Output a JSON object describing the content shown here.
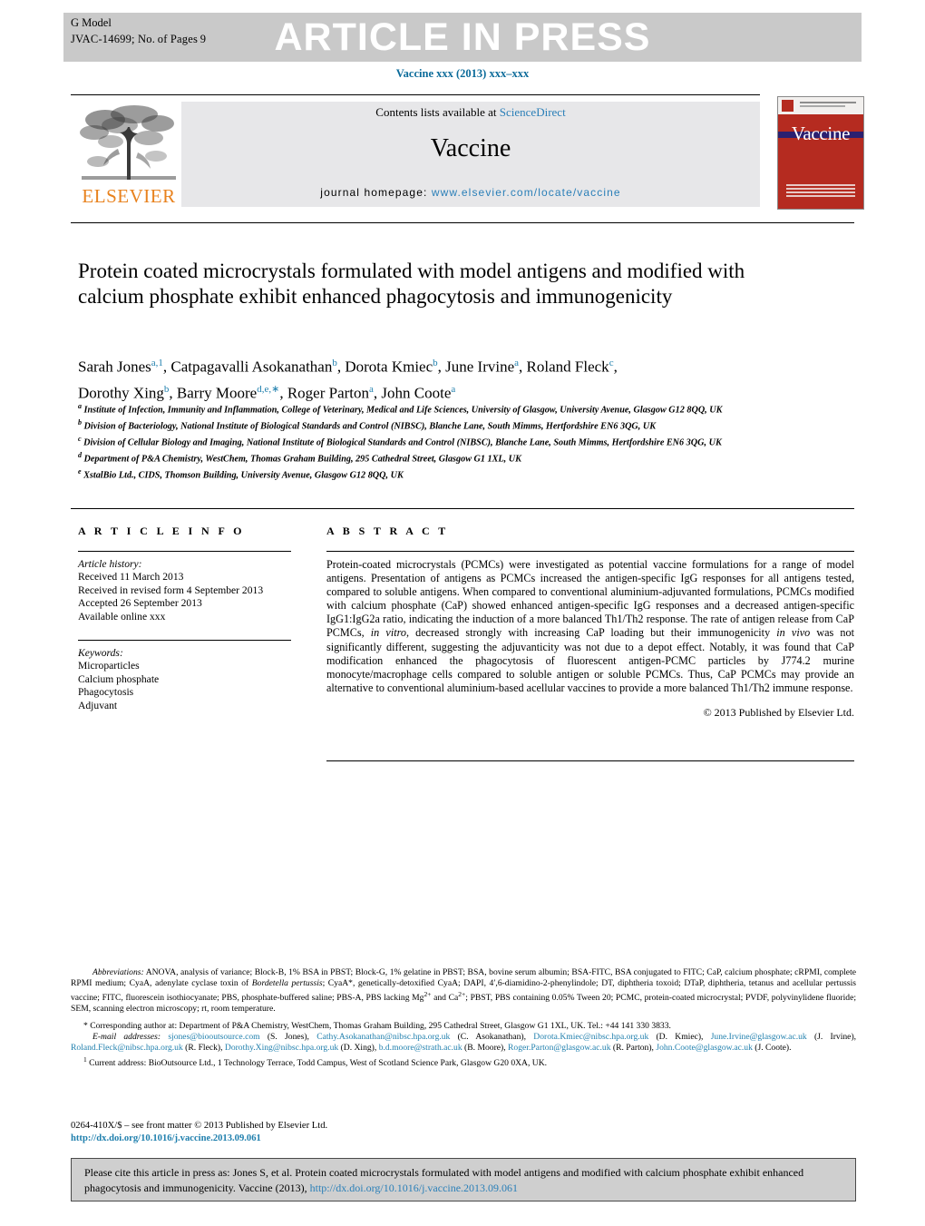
{
  "header": {
    "g_model": "G Model",
    "article_id": "JVAC-14699;   No. of Pages 9",
    "banner": "ARTICLE IN PRESS",
    "journal_ref": "Vaccine xxx (2013) xxx–xxx"
  },
  "masthead": {
    "contents_prefix": "Contents lists available at ",
    "sciencedirect": "ScienceDirect",
    "journal_title": "Vaccine",
    "homepage_label": "journal homepage: ",
    "homepage_url": "www.elsevier.com/locate/vaccine",
    "publisher": "ELSEVIER",
    "cover_title": "Vaccine"
  },
  "article": {
    "title": "Protein coated microcrystals formulated with model antigens and modified with calcium phosphate exhibit enhanced phagocytosis and immunogenicity",
    "authors_line1": "Sarah Jones<sup>a,1</sup>, Catpagavalli Asokanathan<sup>b</sup>, Dorota Kmiec<sup>b</sup>, June Irvine<sup>a</sup>, Roland Fleck<sup>c</sup>,",
    "authors_line2": "Dorothy Xing<sup>b</sup>, Barry Moore<sup>d,e,∗</sup>, Roger Parton<sup>a</sup>, John Coote<sup>a</sup>",
    "affiliations": [
      "<sup>a</sup> Institute of Infection, Immunity and Inflammation, College of Veterinary, Medical and Life Sciences, University of Glasgow, University Avenue, Glasgow G12 8QQ, UK",
      "<sup>b</sup> Division of Bacteriology, National Institute of Biological Standards and Control (NIBSC), Blanche Lane, South Mimms, Hertfordshire EN6 3QG, UK",
      "<sup>c</sup> Division of Cellular Biology and Imaging, National Institute of Biological Standards and Control (NIBSC), Blanche Lane, South Mimms, Hertfordshire EN6 3QG, UK",
      "<sup>d</sup> Department of P&A Chemistry, WestChem, Thomas Graham Building, 295 Cathedral Street, Glasgow G1 1XL, UK",
      "<sup>e</sup> XstalBio Ltd., CIDS, Thomson Building, University Avenue, Glasgow G12 8QQ, UK"
    ]
  },
  "info": {
    "heading": "A R T I C L E   I N F O",
    "history_label": "Article history:",
    "history": [
      "Received 11 March 2013",
      "Received in revised form 4 September 2013",
      "Accepted 26 September 2013",
      "Available online xxx"
    ],
    "keywords_label": "Keywords:",
    "keywords": [
      "Microparticles",
      "Calcium phosphate",
      "Phagocytosis",
      "Adjuvant"
    ]
  },
  "abstract": {
    "heading": "A B S T R A C T",
    "text": "Protein-coated microcrystals (PCMCs) were investigated as potential vaccine formulations for a range of model antigens. Presentation of antigens as PCMCs increased the antigen-specific IgG responses for all antigens tested, compared to soluble antigens. When compared to conventional aluminium-adjuvanted formulations, PCMCs modified with calcium phosphate (CaP) showed enhanced antigen-specific IgG responses and a decreased antigen-specific IgG1:IgG2a ratio, indicating the induction of a more balanced Th1/Th2 response. The rate of antigen release from CaP PCMCs, <i>in vitro</i>, decreased strongly with increasing CaP loading but their immunogenicity <i>in vivo</i> was not significantly different, suggesting the adjuvanticity was not due to a depot effect. Notably, it was found that CaP modification enhanced the phagocytosis of fluorescent antigen-PCMC particles by J774.2 murine monocyte/macrophage cells compared to soluble antigen or soluble PCMCs. Thus, CaP PCMCs may provide an alternative to conventional aluminium-based acellular vaccines to provide a more balanced Th1/Th2 immune response.",
    "copyright": "© 2013 Published by Elsevier Ltd."
  },
  "footnotes": {
    "abbreviations_label": "Abbreviations:",
    "abbreviations_text": "ANOVA, analysis of variance; Block-B, 1% BSA in PBST; Block-G, 1% gelatine in PBST; BSA, bovine serum albumin; BSA-FITC, BSA conjugated to FITC; CaP, calcium phosphate; cRPMI, complete RPMI medium; CyaA, adenylate cyclase toxin of <i>Bordetella pertussis</i>; CyaA*, genetically-detoxified CyaA; DAPI, 4′,6-diamidino-2-phenylindole; DT, diphtheria toxoid; DTaP, diphtheria, tetanus and acellular pertussis vaccine; FITC, fluorescein isothiocyanate; PBS, phosphate-buffered saline; PBS-A, PBS lacking Mg<sup>2+</sup> and Ca<sup>2+</sup>; PBST, PBS containing 0.05% Tween 20; PCMC, protein-coated microcrystal; PVDF, polyvinylidene fluoride; SEM, scanning electron microscopy; rt, room temperature.",
    "corresponding": "* Corresponding author at: Department of P&A Chemistry, WestChem, Thomas Graham Building, 295 Cathedral Street, Glasgow G1 1XL, UK. Tel.: +44 141 330 3833.",
    "email_label": "E-mail addresses:",
    "emails": [
      {
        "address": "sjones@biooutsource.com",
        "name": "(S. Jones)"
      },
      {
        "address": "Cathy.Asokanathan@nibsc.hpa.org.uk",
        "name": "(C. Asokanathan)"
      },
      {
        "address": "Dorota.Kmiec@nibsc.hpa.org.uk",
        "name": "(D. Kmiec),"
      },
      {
        "address": "June.Irvine@glasgow.ac.uk",
        "name": "(J. Irvine)"
      },
      {
        "address": "Roland.Fleck@nibsc.hpa.org.uk",
        "name": "(R. Fleck)"
      },
      {
        "address": "Dorothy.Xing@nibsc.hpa.org.uk",
        "name": "(D. Xing)"
      },
      {
        "address": "b.d.moore@strath.ac.uk",
        "name": "(B. Moore),"
      },
      {
        "address": "Roger.Parton@glasgow.ac.uk",
        "name": "(R. Parton)"
      },
      {
        "address": "John.Coote@glasgow.ac.uk",
        "name": "(J. Coote)."
      }
    ],
    "current_address": "<sup>1</sup> Current address: BioOutsource Ltd., 1 Technology Terrace, Todd Campus, West of Scotland Science Park, Glasgow G20 0XA, UK."
  },
  "frontmatter": {
    "line": "0264-410X/$ – see front matter © 2013 Published by Elsevier Ltd.",
    "doi": "http://dx.doi.org/10.1016/j.vaccine.2013.09.061"
  },
  "cite_box": {
    "text_before": "Please cite this article in press as: Jones S, et al. Protein coated microcrystals formulated with model antigens and modified with calcium phosphate exhibit enhanced phagocytosis and immunogenicity. Vaccine (2013), ",
    "link": "http://dx.doi.org/10.1016/j.vaccine.2013.09.061"
  },
  "colors": {
    "link": "#2a7fb8",
    "elsevier_orange": "#e8821e",
    "cover_red": "#b52b20",
    "banner_grey": "#c9c9c9"
  }
}
